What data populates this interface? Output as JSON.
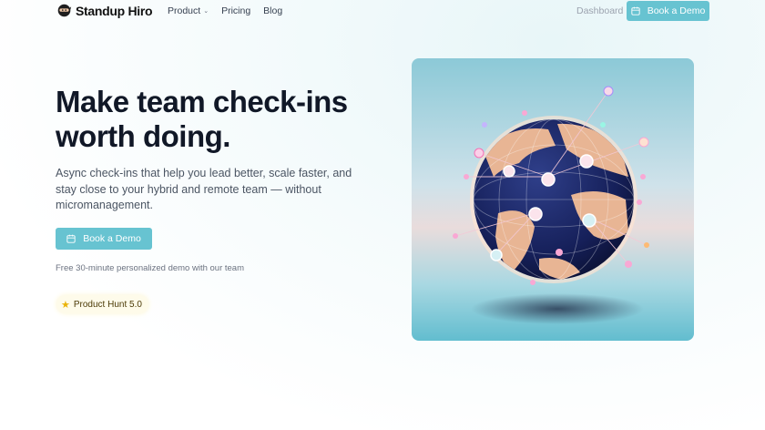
{
  "nav": {
    "brand": "Standup Hiro",
    "links": [
      "Product",
      "Pricing",
      "Blog"
    ],
    "dashboard": "Dashboard",
    "cta": "Book a Demo"
  },
  "hero": {
    "title_line1": "Make team check-ins",
    "title_line2": "worth doing.",
    "subtitle": "Async check-ins that help you lead better, scale faster, and stay close to your hybrid and remote team — without micromanagement.",
    "cta": "Book a Demo",
    "note": "Free 30-minute personalized demo with our team",
    "badge": "Product Hunt 5.0"
  },
  "colors": {
    "accent": "#67c3d1",
    "heading": "#111827",
    "body": "#4b5563"
  },
  "icons": [
    "ninja-logo-icon",
    "chevron-down-icon",
    "calendar-icon",
    "star-icon"
  ]
}
